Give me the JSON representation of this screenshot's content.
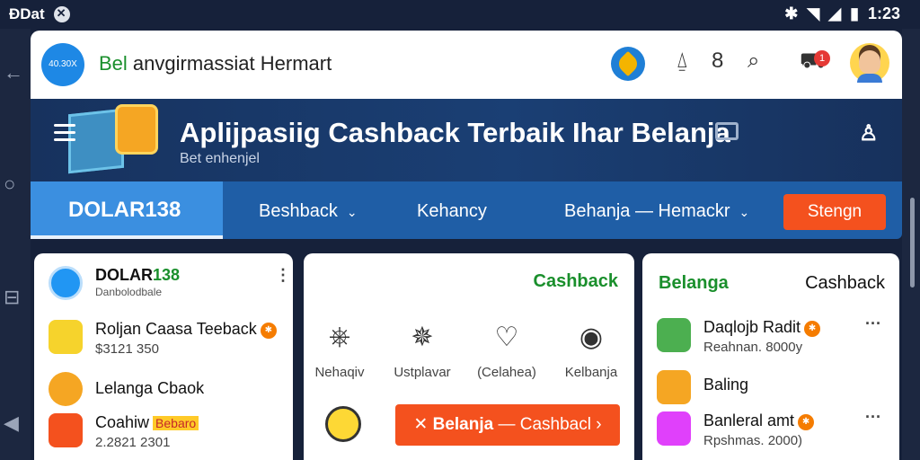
{
  "status_bar": {
    "left_text": "ÐDat",
    "time": "1:23"
  },
  "header": {
    "logo_text": "40.30X",
    "brand_prefix": "Bel",
    "brand_rest": "anvgirmassiat Hermart",
    "menu_glyph": "8",
    "cart_badge": "1"
  },
  "hero": {
    "title": "Aplijpasiig Cashback Terbaik Ihar Belanja",
    "subtitle": "Bet enhenjel"
  },
  "tabs": {
    "active": "DOLAR138",
    "items": [
      {
        "label": "Beshback"
      },
      {
        "label": "Kehancy"
      },
      {
        "label": "Behanja — Hemackr"
      }
    ],
    "signin_label": "Stengn"
  },
  "left_panel": {
    "title_black": "DOLAR",
    "title_green": "138",
    "subtitle": "Danbolodbale",
    "items": [
      {
        "title": "Roljan Caasa Teeback",
        "sub": "$3121 350",
        "badge": "✱",
        "color": "#f6d32c"
      },
      {
        "title": "Lelanga Cbaok",
        "sub": "",
        "badge": "",
        "color": "#f5a623"
      },
      {
        "title": "Coahiw",
        "highlight": "Bebaro",
        "sub": "2.2821 2301",
        "color": "#f4511e"
      }
    ]
  },
  "middle_panel": {
    "heading": "Cashback",
    "categories": [
      {
        "icon": "bag-icon",
        "glyph": "⎈",
        "label": "Nehaqiv"
      },
      {
        "icon": "star-badge-icon",
        "glyph": "✵",
        "label": "Ustplavar"
      },
      {
        "icon": "heart-icon",
        "glyph": "♡",
        "label": "(Celahea)"
      },
      {
        "icon": "location-icon",
        "glyph": "◉",
        "label": "Kelbanja"
      }
    ],
    "cta_main": "Belanja",
    "cta_rest": "— Cashbacl ›"
  },
  "right_panel": {
    "tab_active": "Belanga",
    "tab_other": "Cashback",
    "items": [
      {
        "title": "Daqlojb Radit",
        "sub": "Reahnan. 8000y",
        "badge": "✱",
        "color": "#4caf50"
      },
      {
        "title": "Baling",
        "sub": "",
        "badge": "",
        "color": "#f5a623"
      },
      {
        "title": "Banleral amt",
        "sub": "Rpshmas. 2000)",
        "badge": "✱",
        "color": "#e040fb"
      }
    ]
  }
}
